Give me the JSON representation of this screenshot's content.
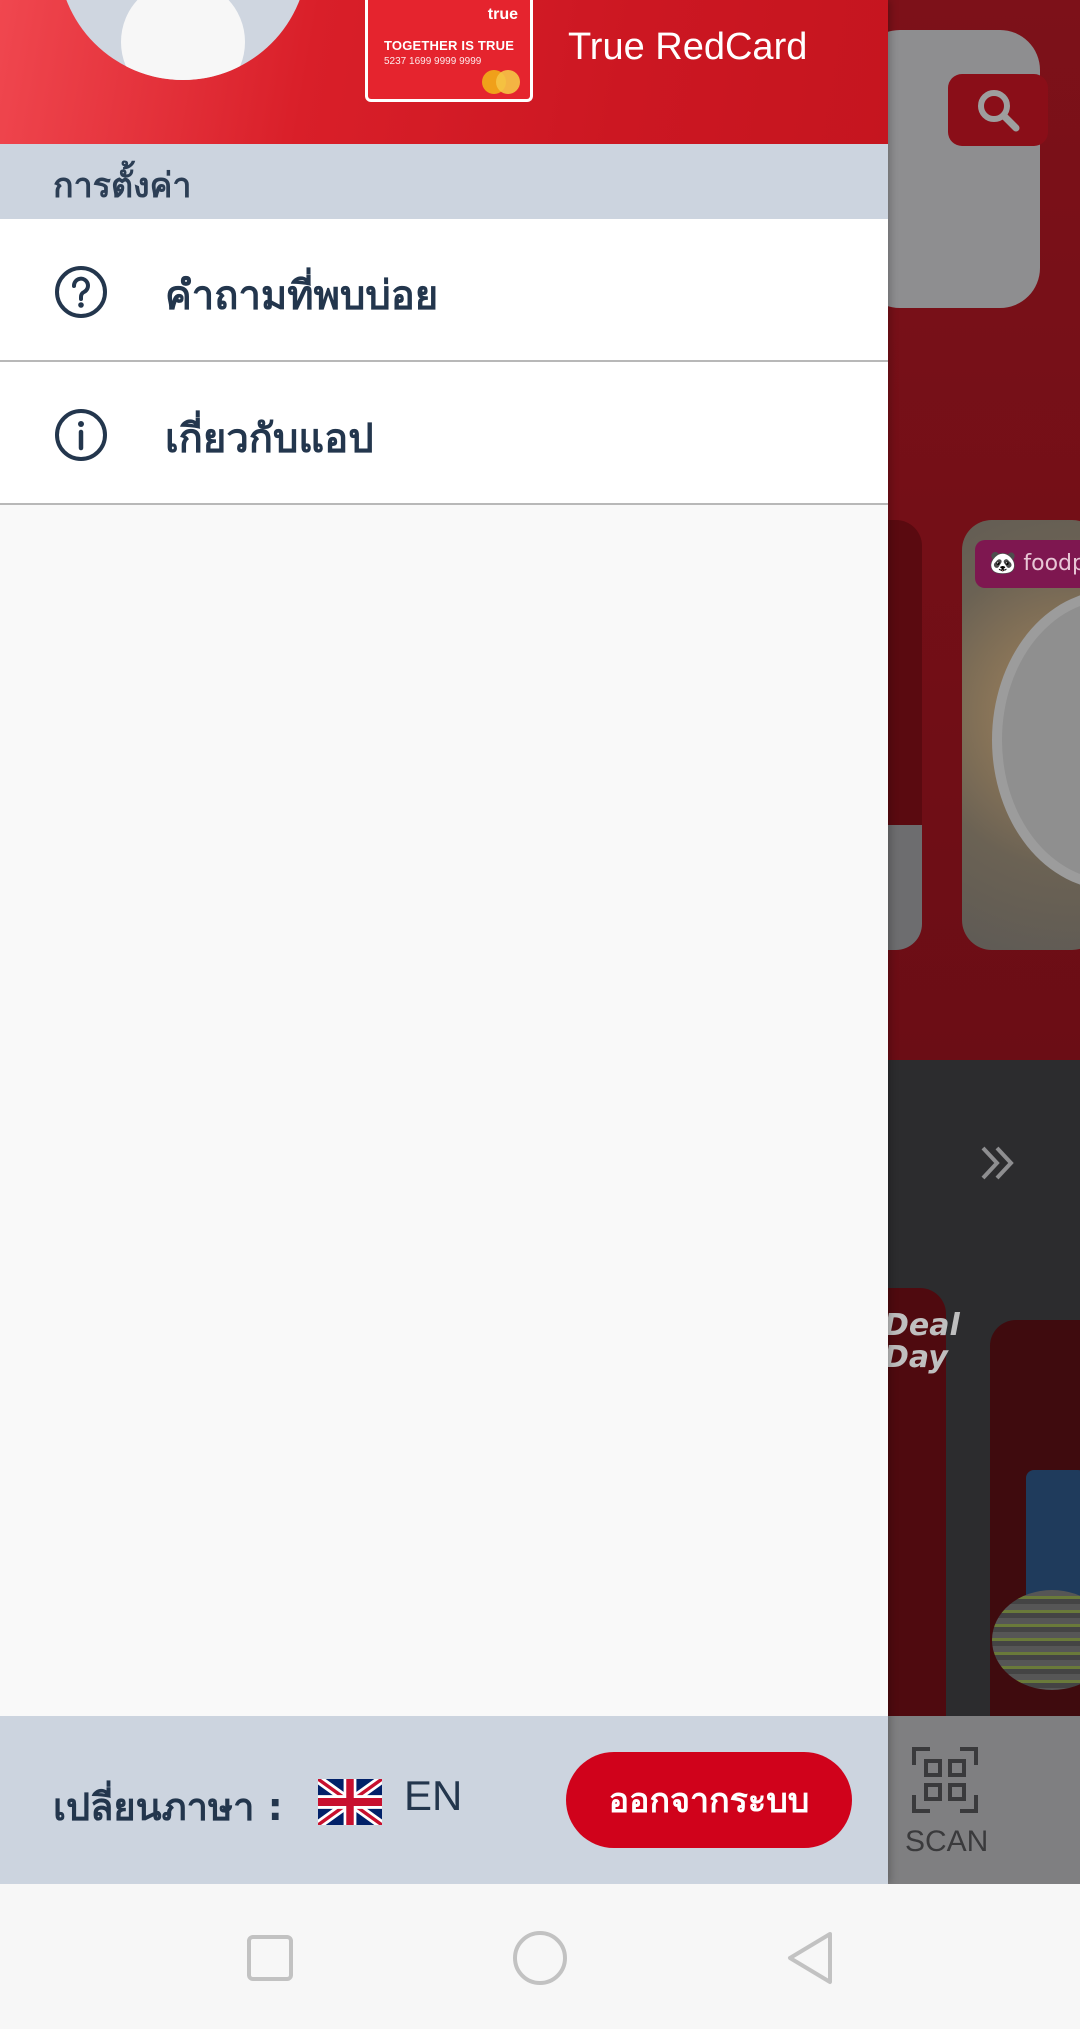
{
  "drawer": {
    "header": {
      "card_brand": "true",
      "card_tagline": "TOGETHER IS TRUE",
      "card_number": "5237 1699 9999 9999",
      "card_title": "True RedCard"
    },
    "section_title": "การตั้งค่า",
    "menu": [
      {
        "label": "คำถามที่พบบ่อย",
        "icon": "question-circle-icon"
      },
      {
        "label": "เกี่ยวกับแอป",
        "icon": "info-circle-icon"
      }
    ],
    "footer": {
      "language_label": "เปลี่ยนภาษา :",
      "language_flag": "uk-flag-icon",
      "language_code": "EN",
      "logout_label": "ออกจากระบบ"
    }
  },
  "background": {
    "foodpanda_label": "foodpa",
    "deal_text": "Deal of the Day",
    "scan_label": "SCAN"
  },
  "colors": {
    "header_red": "#d91f29",
    "section_bg": "#ccd4df",
    "text_navy": "#23364d",
    "logout_red": "#d0021b"
  }
}
